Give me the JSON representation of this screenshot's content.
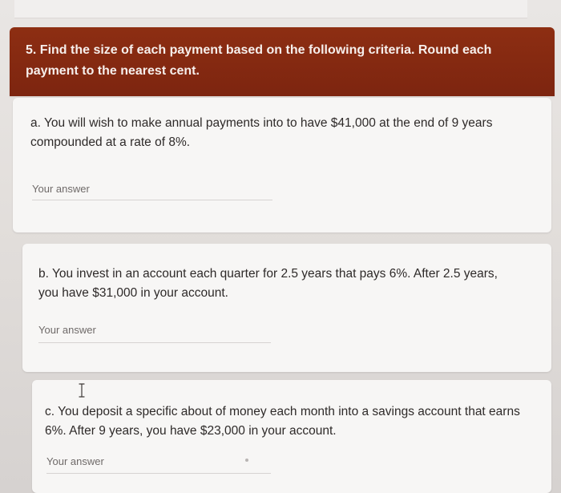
{
  "header": {
    "title": "5. Find the size of each payment based on the following criteria. Round each payment to the nearest cent."
  },
  "questions": [
    {
      "text": "a. You will wish to make annual payments into to have $41,000 at the end of 9 years compounded at a rate of 8%.",
      "placeholder": "Your answer"
    },
    {
      "text": "b. You invest in an account each quarter for 2.5 years that pays 6%. After 2.5 years, you have $31,000 in your account.",
      "placeholder": "Your answer"
    },
    {
      "text": "c. You deposit a specific about of money each month into a savings account that earns 6%. After 9 years, you have $23,000 in your account.",
      "placeholder": "Your answer"
    }
  ],
  "colors": {
    "header_band": "#7f2711",
    "card_background": "#f7f6f5",
    "text": "#2e2a29",
    "placeholder": "#6f6a69"
  },
  "icons": {
    "text_cursor": "text-cursor-icon"
  }
}
